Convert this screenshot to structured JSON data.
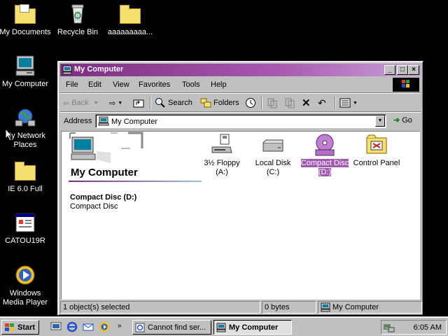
{
  "desktop": {
    "icons": [
      {
        "label": "My Documents",
        "icon": "folder-documents-icon"
      },
      {
        "label": "Recycle Bin",
        "icon": "recycle-bin-icon"
      },
      {
        "label": "aaaaaaaaa...",
        "icon": "folder-icon"
      },
      {
        "label": "My Computer",
        "icon": "computer-icon"
      },
      {
        "label_line1": "My Network",
        "label_line2": "Places",
        "icon": "network-icon"
      },
      {
        "label": "IE 6.0 Full",
        "icon": "folder-icon"
      },
      {
        "label": "CATOU19R",
        "icon": "program-icon"
      },
      {
        "label_line1": "Windows",
        "label_line2": "Media Player",
        "icon": "media-player-icon"
      }
    ]
  },
  "window": {
    "title": "My Computer",
    "controls": {
      "minimize": "_",
      "maximize": "□",
      "close": "×"
    },
    "menu": [
      "File",
      "Edit",
      "View",
      "Favorites",
      "Tools",
      "Help"
    ],
    "toolbar": {
      "back": "Back",
      "search": "Search",
      "folders": "Folders"
    },
    "address": {
      "label": "Address",
      "value": "My Computer",
      "go": "Go"
    },
    "info_pane": {
      "title": "My Computer",
      "selected_name": "Compact Disc (D:)",
      "selected_type": "Compact Disc"
    },
    "items": [
      {
        "line1": "3½ Floppy",
        "line2": "(A:)",
        "icon": "floppy-drive-icon",
        "selected": false
      },
      {
        "line1": "Local Disk (C:)",
        "line2": "",
        "icon": "hard-disk-icon",
        "selected": false
      },
      {
        "line1": "Compact Disc",
        "line2": "(D:)",
        "icon": "cd-drive-icon",
        "selected": true
      },
      {
        "line1": "Control Panel",
        "line2": "",
        "icon": "control-panel-icon",
        "selected": false
      }
    ],
    "status": {
      "objects": "1 object(s) selected",
      "size": "0 bytes",
      "zone": "My Computer"
    }
  },
  "taskbar": {
    "start": "Start",
    "tasks": [
      {
        "label": "Cannot find ser...",
        "active": false
      },
      {
        "label": "My Computer",
        "active": true
      }
    ],
    "clock": "6:05 AM"
  },
  "colors": {
    "title_active": "#7b2d83",
    "selection": "#a058b0",
    "desktop": "#000000",
    "face": "#c0c0c0"
  }
}
